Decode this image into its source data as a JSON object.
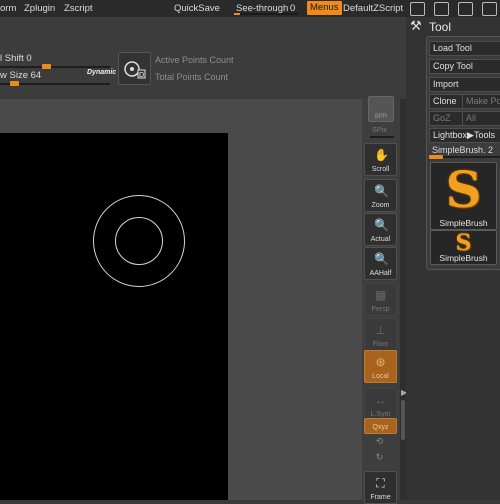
{
  "topbar": {
    "items": [
      "orm",
      "Zplugin",
      "Zscript"
    ],
    "quicksave": "QuickSave",
    "see_through_label": "See-through",
    "see_through_value": "0",
    "see_through_fraction": 0.0,
    "menus": "Menus",
    "default_zscript": "DefaultZScript"
  },
  "header": {
    "draw_shift": "l Shift 0",
    "draw_size": "w Size 64",
    "dynamic": "Dynamic",
    "active_points": "Active Points Count",
    "total_points": "Total Points Count"
  },
  "shelf": {
    "bpr": "BPR",
    "spix": "SPix",
    "scroll": "Scroll",
    "zoom": "Zoom",
    "actual": "Actual",
    "aahalf": "AAHalf",
    "persp": "Persp",
    "floor": "Floor",
    "local": "Local",
    "lsym": "L.Sym",
    "xyz": "Qxyz",
    "frame": "Frame"
  },
  "tool_panel": {
    "title": "Tool",
    "load_tool": "Load Tool",
    "copy_tool": "Copy Tool",
    "import": "Import",
    "clone": "Clone",
    "make_polymesh": "Make Po",
    "goz": "GoZ",
    "all": "All",
    "lightbox_tools": "Lightbox▶Tools",
    "brush_slider_label": "SimpleBrush. 2",
    "brush_large_label": "SimpleBrush",
    "brush_small_label": "SimpleBrush"
  },
  "colors": {
    "accent": "#f08b1a",
    "background": "#3a3a3a",
    "viewport": "#000000"
  }
}
